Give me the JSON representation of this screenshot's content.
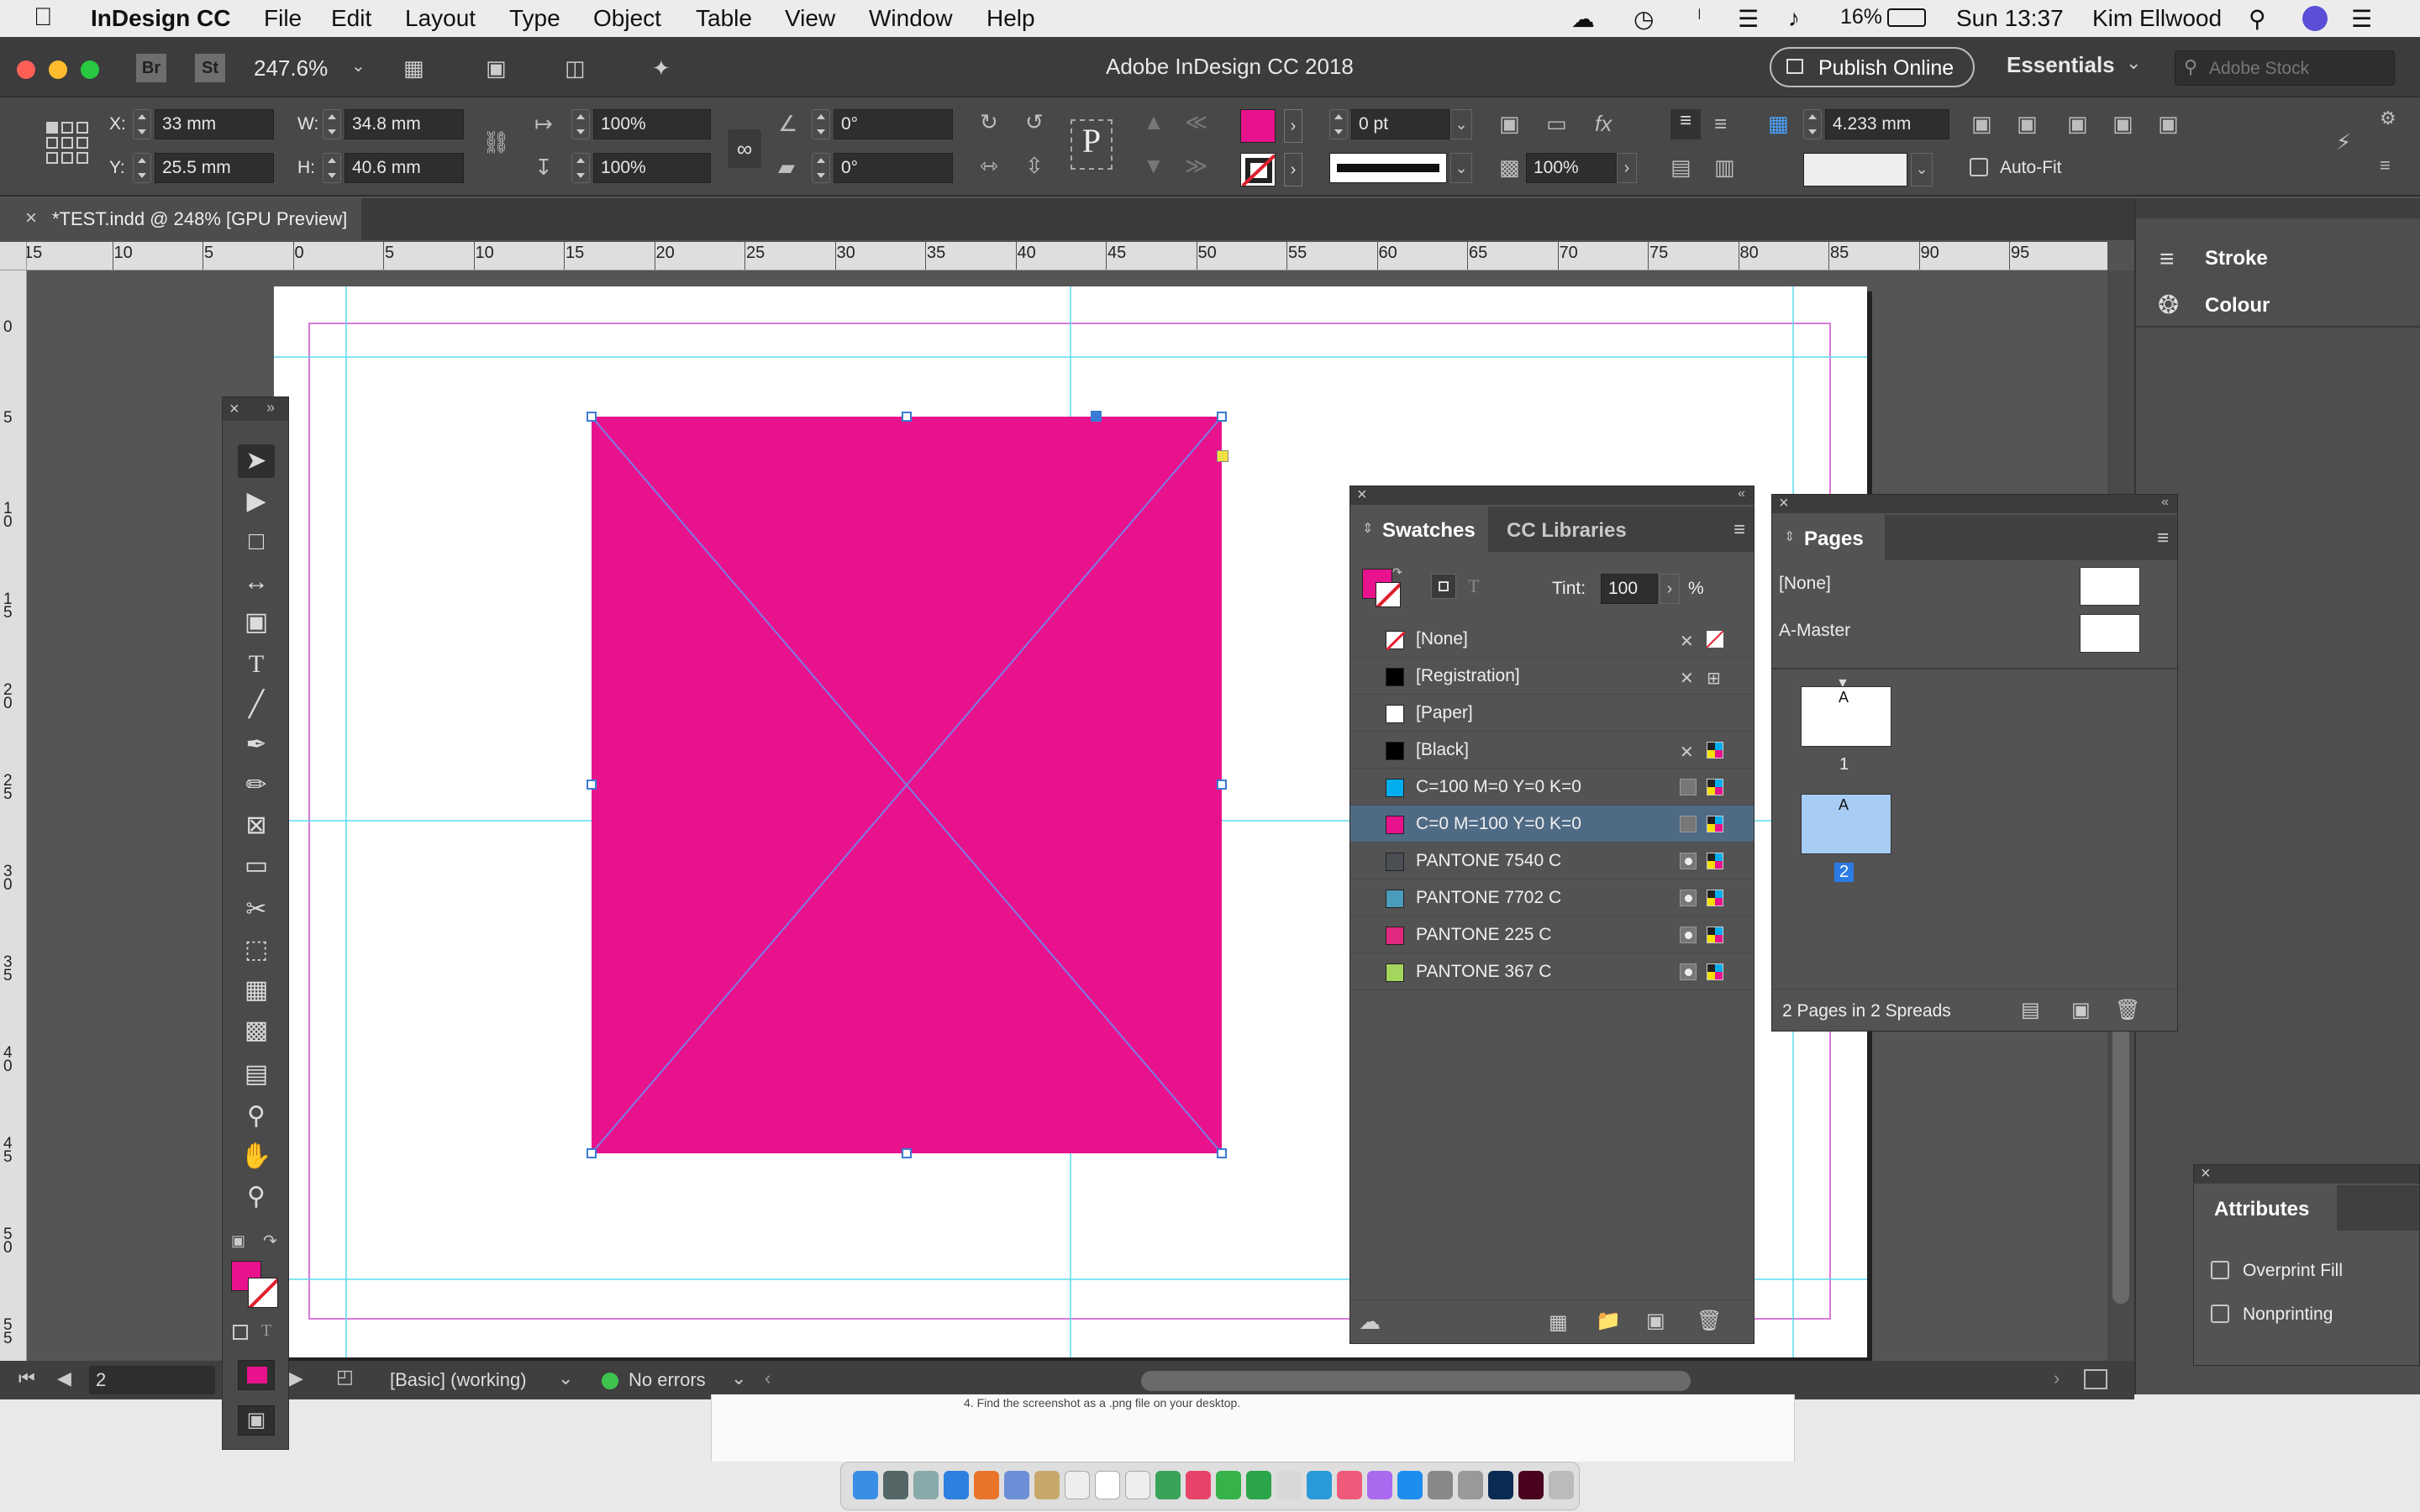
{
  "menubar": {
    "app_name": "InDesign CC",
    "items": [
      "File",
      "Edit",
      "Layout",
      "Type",
      "Object",
      "Table",
      "View",
      "Window",
      "Help"
    ],
    "battery": "16%",
    "clock": "Sun 13:37",
    "user": "Kim Ellwood"
  },
  "titlebar": {
    "window_title": "Adobe InDesign CC 2018",
    "zoom": "247.6%",
    "bridge_label": "Br",
    "stock_label": "St",
    "publish_label": "Publish Online",
    "workspace": "Essentials",
    "stock_search_placeholder": "Adobe Stock"
  },
  "control": {
    "x_label": "X:",
    "x_value": "33 mm",
    "y_label": "Y:",
    "y_value": "25.5 mm",
    "w_label": "W:",
    "w_value": "34.8 mm",
    "h_label": "H:",
    "h_value": "40.6 mm",
    "scale_x": "100%",
    "scale_y": "100%",
    "rotate": "0°",
    "shear": "0°",
    "stroke_weight": "0 pt",
    "opacity": "100%",
    "spacing": "4.233 mm",
    "autofit_label": "Auto-Fit",
    "fill_color": "#e8128c"
  },
  "document": {
    "tab_title": "*TEST.indd @ 248% [GPU Preview]",
    "ruler_top": [
      "15",
      "10",
      "5",
      "0",
      "5",
      "10",
      "15",
      "20",
      "25",
      "30",
      "35",
      "40",
      "45",
      "50",
      "55",
      "60",
      "65",
      "70",
      "75",
      "80",
      "85",
      "90",
      "95"
    ],
    "ruler_left": [
      "0",
      "5",
      "10",
      "15",
      "20",
      "25",
      "30",
      "35",
      "40",
      "45",
      "50",
      "55"
    ],
    "frame_color": "#e8128c"
  },
  "statusbar": {
    "page": "2",
    "preflight_profile": "[Basic] (working)",
    "errors": "No errors"
  },
  "swatches": {
    "tab_active": "Swatches",
    "tab_other": "CC Libraries",
    "tint_label": "Tint:",
    "tint_value": "100",
    "tint_unit": "%",
    "items": [
      {
        "name": "[None]",
        "color": "#ffffff"
      },
      {
        "name": "[Registration]",
        "color": "#000000"
      },
      {
        "name": "[Paper]",
        "color": "#ffffff"
      },
      {
        "name": "[Black]",
        "color": "#000000"
      },
      {
        "name": "C=100 M=0 Y=0 K=0",
        "color": "#00aeef"
      },
      {
        "name": "C=0 M=100 Y=0 K=0",
        "color": "#e8128c"
      },
      {
        "name": "PANTONE 7540 C",
        "color": "#4b4f54"
      },
      {
        "name": "PANTONE 7702 C",
        "color": "#4a9cbb"
      },
      {
        "name": "PANTONE 225 C",
        "color": "#e0287f"
      },
      {
        "name": "PANTONE 367 C",
        "color": "#a4d65e"
      }
    ]
  },
  "pages": {
    "title": "Pages",
    "masters": [
      "[None]",
      "A-Master"
    ],
    "page1_label": "1",
    "page2_label": "2",
    "master_letter": "A",
    "summary": "2 Pages in 2 Spreads"
  },
  "right_panel": {
    "stroke": "Stroke",
    "colour": "Colour"
  },
  "attributes": {
    "title": "Attributes",
    "overprint": "Overprint Fill",
    "nonprinting": "Nonprinting"
  },
  "behind_doc_text": "4. Find the screenshot as a .png file on your desktop."
}
